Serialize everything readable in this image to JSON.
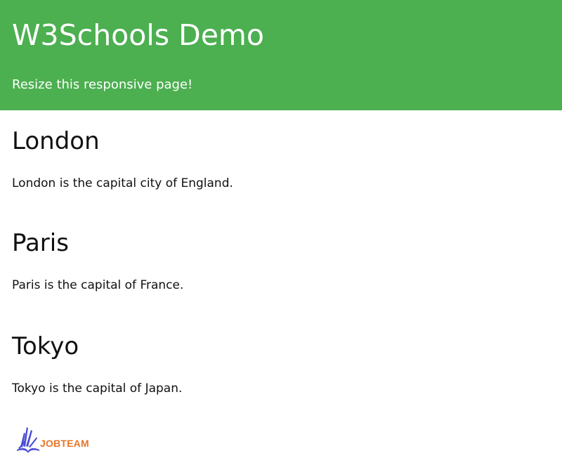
{
  "header": {
    "title": "W3Schools Demo",
    "subtitle": "Resize this responsive page!",
    "background_color": "#4caf50"
  },
  "sections": [
    {
      "heading": "London",
      "text": "London is the capital city of England."
    },
    {
      "heading": "Paris",
      "text": "Paris is the capital of France."
    },
    {
      "heading": "Tokyo",
      "text": "Tokyo is the capital of Japan."
    }
  ],
  "watermark": {
    "text": "JOBTEAM",
    "icon": "book-logo-icon",
    "color": "#e8752a",
    "icon_color": "#4b4bd6"
  }
}
